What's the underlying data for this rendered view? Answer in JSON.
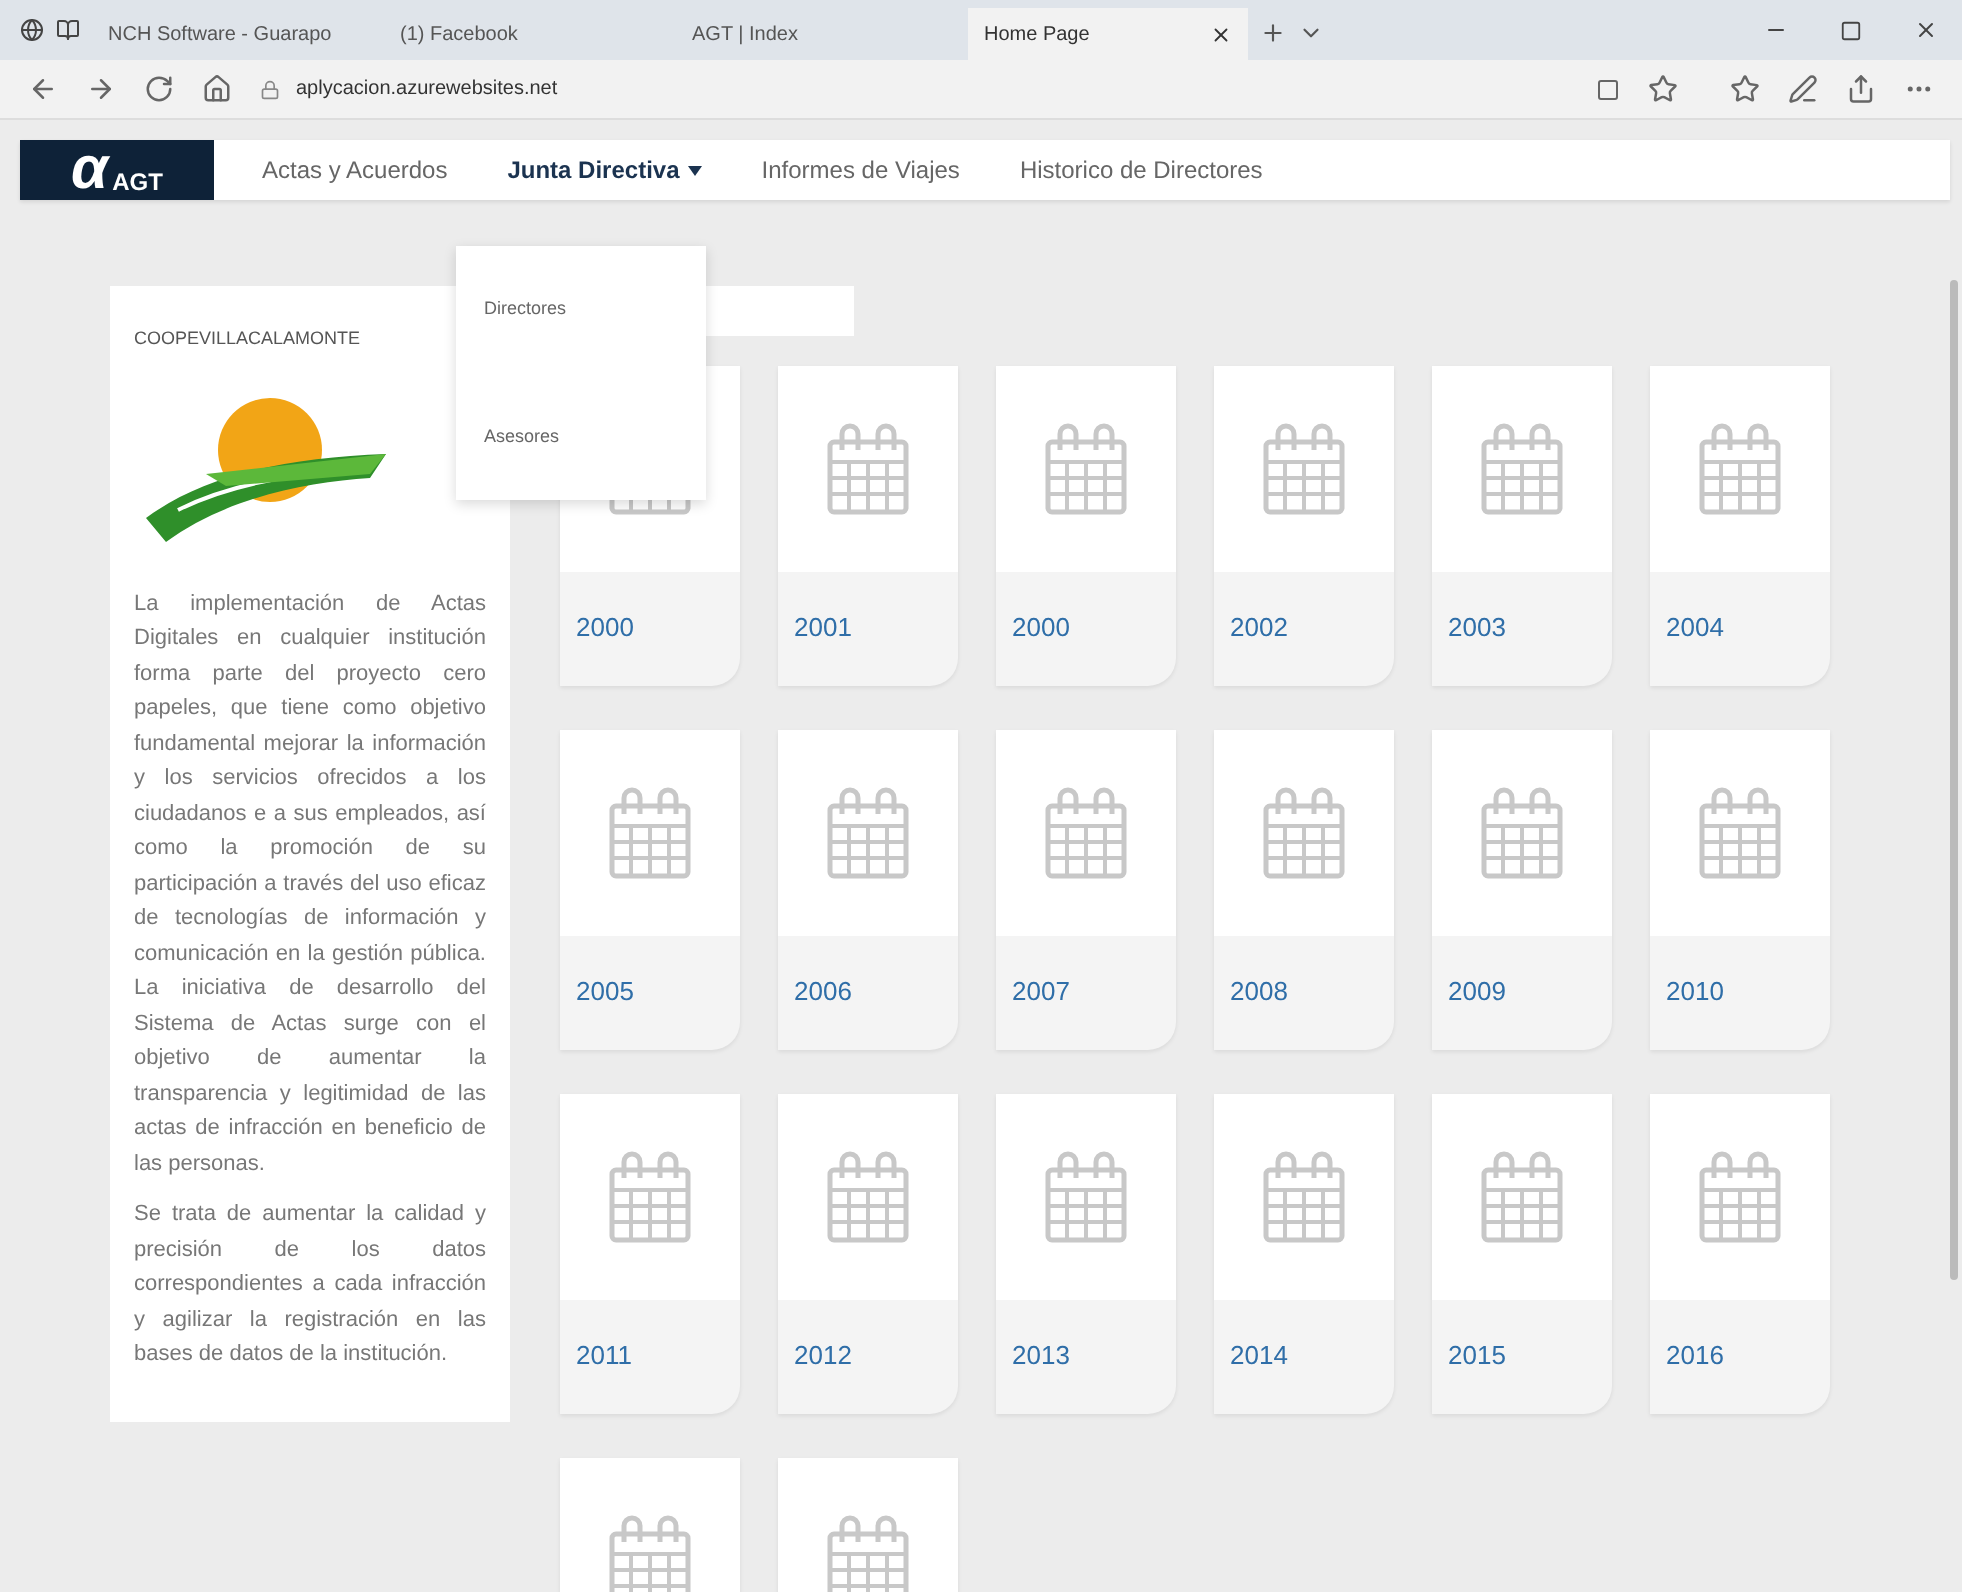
{
  "browser": {
    "tabs": [
      {
        "label": "NCH Software - Guarapo",
        "selected": false
      },
      {
        "label": "(1) Facebook",
        "selected": false
      },
      {
        "label": "AGT | Index",
        "selected": false
      },
      {
        "label": "Home Page",
        "selected": true
      }
    ],
    "address": "aplycacion.azurewebsites.net"
  },
  "navbar": {
    "logo_symbol": "α",
    "logo_text": "AGT",
    "items": [
      {
        "label": "Actas y Acuerdos",
        "kind": "link",
        "selected": false
      },
      {
        "label": "Junta Directiva",
        "kind": "dropdown",
        "selected": true
      },
      {
        "label": "Informes de Viajes",
        "kind": "link",
        "selected": false
      },
      {
        "label": "Historico de Directores",
        "kind": "link",
        "selected": false
      }
    ]
  },
  "dropdown": {
    "items": [
      "Directores",
      "Asesores"
    ]
  },
  "sidebar": {
    "title": "COOPEVILLACALAMONTE",
    "paragraphs": [
      "La implementación de Actas Digitales en cualquier institución forma parte del proyecto cero papeles, que tiene como objetivo fundamental mejorar la información y los servicios ofrecidos a los ciudadanos e a sus empleados, así como la promoción de su participación a través del uso eficaz de tecnologías de información y comunicación en la gestión pública. La iniciativa de desarrollo del Sistema de Actas surge con el objetivo de aumentar la transparencia y legitimidad de las actas de infracción en beneficio de las personas.",
      "Se trata de aumentar la calidad y precisión de los datos correspondientes a cada infracción y agilizar la registración en las bases de datos de la institución."
    ]
  },
  "years": [
    "2000",
    "2001",
    "2000",
    "2002",
    "2003",
    "2004",
    "2005",
    "2006",
    "2007",
    "2008",
    "2009",
    "2010",
    "2011",
    "2012",
    "2013",
    "2014",
    "2015",
    "2016"
  ]
}
